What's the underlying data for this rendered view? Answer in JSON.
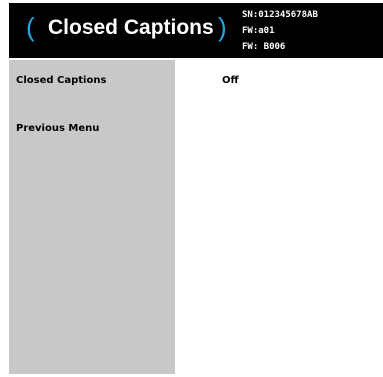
{
  "header": {
    "left_paren": "(",
    "title": "Closed Captions",
    "right_paren": ")",
    "serial": "SN:012345678AB",
    "firmware_1": "FW:a01",
    "firmware_2": "FW: B006"
  },
  "sidebar": {
    "items": [
      {
        "label": "Closed Captions"
      },
      {
        "label": "Previous Menu"
      }
    ]
  },
  "main": {
    "closed_captions_value": "Off"
  },
  "colors": {
    "header_bg": "#000000",
    "accent_paren": "#1fa8e0",
    "sidebar_bg": "#c8c8c8",
    "content_bg": "#ffffff"
  }
}
